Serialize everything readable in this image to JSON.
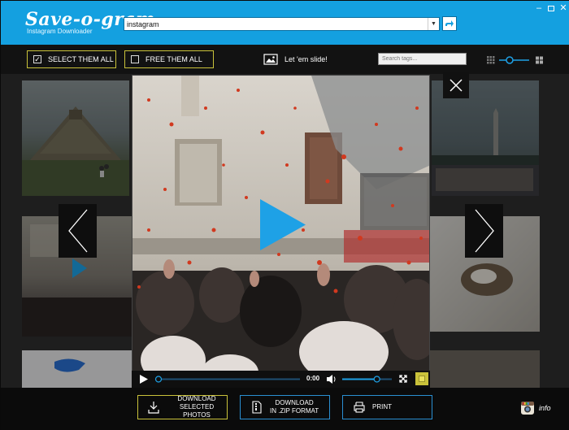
{
  "app": {
    "logo": "Save-o-gram",
    "logo_sub": "Instagram Downloader",
    "search_value": "instagram",
    "window_controls": [
      "minimize",
      "maximize",
      "close"
    ]
  },
  "toolbar": {
    "select_all_label": "SELECT THEM ALL",
    "free_all_label": "FREE THEM ALL",
    "slideshow_label": "Let 'em slide!",
    "tag_search_placeholder": "Search tags...",
    "zoom_level": 0.35
  },
  "player": {
    "time": "0:00",
    "progress": 0.0,
    "volume": 0.7
  },
  "bottom": {
    "download_selected_line1": "DOWNLOAD",
    "download_selected_line2": "SELECTED PHOTOS",
    "download_zip_line1": "DOWNLOAD",
    "download_zip_line2": "IN .ZIP FORMAT",
    "print_label": "PRINT",
    "info_label": "info"
  },
  "colors": {
    "header_blue": "#14a0e0",
    "accent_yellow": "#c9c23a",
    "play_blue": "#1ea1e6",
    "zip_border": "#2a8fd2",
    "print_border": "#2a8fd2"
  }
}
